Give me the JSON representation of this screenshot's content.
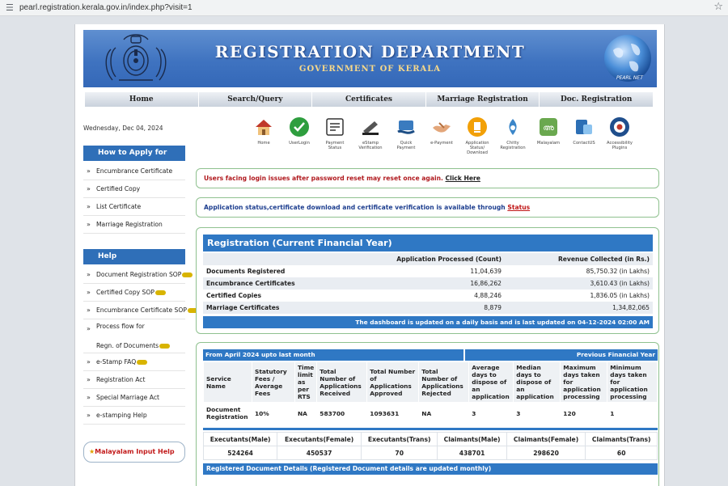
{
  "browser": {
    "url": "pearl.registration.kerala.gov.in/index.php?visit=1"
  },
  "banner": {
    "title": "REGISTRATION DEPARTMENT",
    "subtitle": "GOVERNMENT OF KERALA",
    "logo_text": "PEARL NET"
  },
  "nav": [
    "Home",
    "Search/Query",
    "Certificates",
    "Marriage Registration",
    "Doc. Registration"
  ],
  "date": "Wednesday, Dec 04, 2024",
  "quick_links": [
    {
      "label": "Home",
      "icon": "home-icon"
    },
    {
      "label": "UserLogin",
      "icon": "user-login-icon"
    },
    {
      "label": "Payment Status",
      "icon": "payment-status-icon"
    },
    {
      "label": "eStamp Verification",
      "icon": "estamp-icon"
    },
    {
      "label": "Quick Payment",
      "icon": "quick-payment-icon"
    },
    {
      "label": "e-Payment",
      "icon": "epayment-icon"
    },
    {
      "label": "Application Status/ Download",
      "icon": "application-status-icon"
    },
    {
      "label": "Chitty Registration",
      "icon": "chitty-icon"
    },
    {
      "label": "Malayalam",
      "icon": "malayalam-icon"
    },
    {
      "label": "ContactUS",
      "icon": "contact-icon"
    },
    {
      "label": "Accessibility Plugins",
      "icon": "accessibility-icon"
    }
  ],
  "sidebar": {
    "apply_title": "How to Apply for",
    "apply_items": [
      "Encumbrance Certificate",
      "Certified Copy",
      "List Certificate",
      "Marriage Registration"
    ],
    "help_title": "Help",
    "help_items": [
      "Document Registration SOP",
      "Certified Copy SOP",
      "Encumbrance Certificate SOP",
      "Process flow for",
      "Regn. of Documents",
      "e-Stamp FAQ",
      "Registration Act",
      "Special Marriage Act",
      "e-stamping Help"
    ],
    "malayalam_help": "Malayalam Input Help"
  },
  "notices": {
    "login_text": "Users facing login issues after password reset may reset once again.",
    "login_link": "Click Here",
    "status_text": "Application status,certificate download and certificate verification is available through",
    "status_link": "Status"
  },
  "registration": {
    "title": "Registration (Current Financial Year)",
    "col_count": "Application Processed (Count)",
    "col_revenue": "Revenue Collected (in Rs.)",
    "rows": [
      {
        "label": "Documents Registered",
        "count": "11,04,639",
        "revenue": "85,750.32 (in Lakhs)"
      },
      {
        "label": "Encumbrance Certificates",
        "count": "16,86,262",
        "revenue": "3,610.43 (in Lakhs)"
      },
      {
        "label": "Certified Copies",
        "count": "4,88,246",
        "revenue": "1,836.05 (in Lakhs)"
      },
      {
        "label": "Marriage Certificates",
        "count": "8,879",
        "revenue": "1,34,82,065"
      }
    ],
    "footer": "The dashboard is updated on a daily basis and is last updated on 04-12-2024 02:00 AM"
  },
  "services": {
    "head_left": "From April 2024 upto last month",
    "head_right": "Previous Financial Year",
    "columns": [
      "Service Name",
      "Statutory Fees / Average Fees",
      "Time limit as per RTS",
      "Total Number of Applications Received",
      "Total Number of Applications Approved",
      "Total Number of Applications Rejected",
      "Average days to dispose of an application",
      "Median days to dispose of an application",
      "Maximum days taken for application processing",
      "Minimum days taken for application processing"
    ],
    "row": [
      "Document Registration",
      "10%",
      "NA",
      "583700",
      "1093631",
      "NA",
      "3",
      "3",
      "120",
      "1"
    ]
  },
  "executants": {
    "headers": [
      "Executants(Male)",
      "Executants(Female)",
      "Executants(Trans)",
      "Claimants(Male)",
      "Claimants(Female)",
      "Claimants(Trans)"
    ],
    "values": [
      "524264",
      "450537",
      "70",
      "438701",
      "298620",
      "60"
    ]
  },
  "doc_details_title": "Registered Document Details (Registered Document details are updated monthly)",
  "colors": {
    "accent_blue": "#2f78c4",
    "notice_red": "#b0191e",
    "notice_blue": "#1d3e8f"
  }
}
